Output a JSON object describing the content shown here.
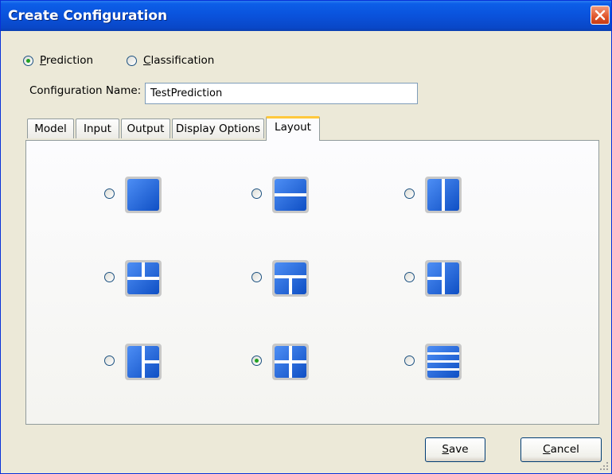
{
  "window": {
    "title": "Create Configuration"
  },
  "mode": {
    "options": [
      {
        "key": "P",
        "rest": "rediction",
        "checked": true
      },
      {
        "key": "C",
        "rest": "lassification",
        "checked": false
      }
    ]
  },
  "config_name": {
    "label": "Configuration Name:",
    "value": "TestPrediction"
  },
  "tabs": [
    {
      "label": "Model"
    },
    {
      "label": "Input"
    },
    {
      "label": "Output"
    },
    {
      "label": "Display Options"
    },
    {
      "label": "Layout",
      "active": true
    }
  ],
  "layout_options": [
    {
      "icon": "single-pane-layout-icon",
      "checked": false
    },
    {
      "icon": "two-rows-layout-icon",
      "checked": false
    },
    {
      "icon": "two-columns-layout-icon",
      "checked": false
    },
    {
      "icon": "two-top-one-bottom-layout-icon",
      "checked": false
    },
    {
      "icon": "one-top-two-bottom-layout-icon",
      "checked": false
    },
    {
      "icon": "one-left-two-right-layout-icon",
      "checked": false
    },
    {
      "icon": "two-left-one-right-layout-icon",
      "checked": false
    },
    {
      "icon": "four-grid-layout-icon",
      "checked": true
    },
    {
      "icon": "four-rows-layout-icon",
      "checked": false
    }
  ],
  "buttons": {
    "save": {
      "key": "S",
      "rest": "ave"
    },
    "cancel": {
      "key": "C",
      "rest": "ancel"
    }
  },
  "colors": {
    "title_bar": "#0a52db",
    "pane_blue": "#1a5fd6",
    "selected_radio": "#21a121",
    "active_tab_highlight": "#ffc83c"
  }
}
